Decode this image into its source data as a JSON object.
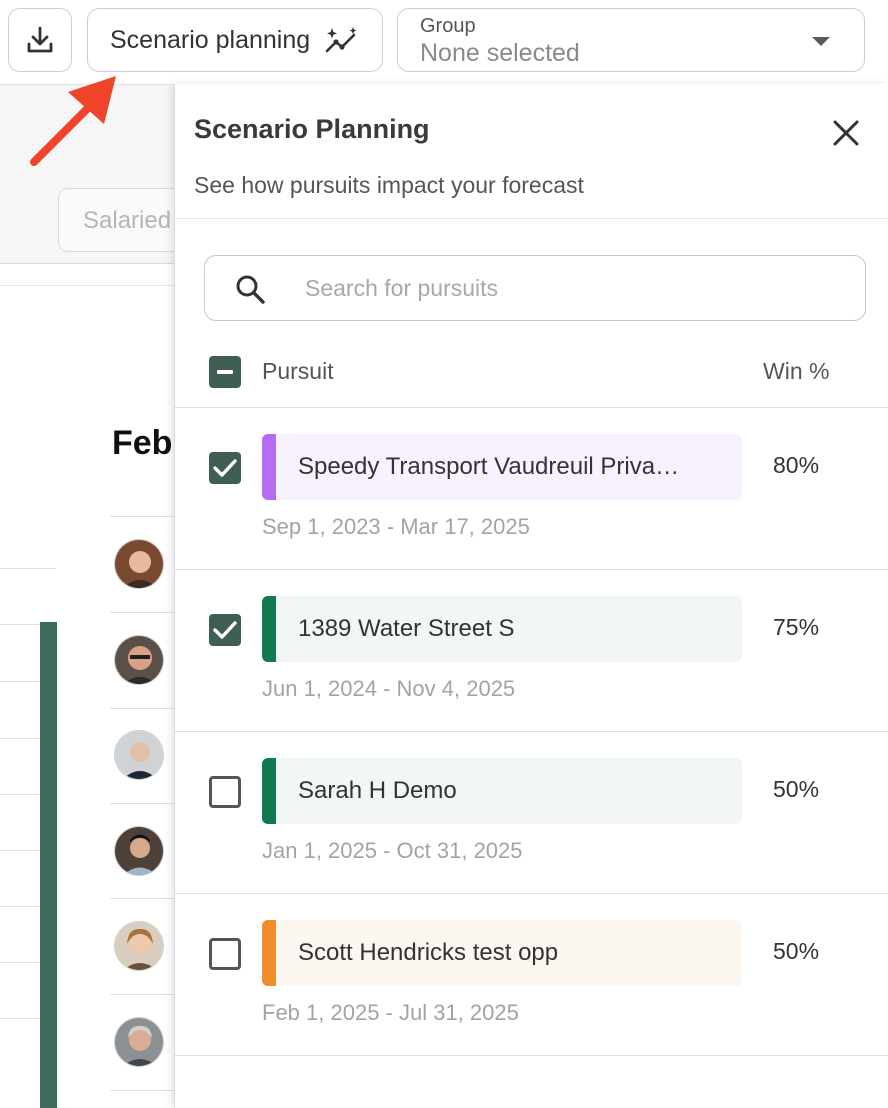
{
  "toolbar": {
    "download_icon": "download-icon",
    "scenario_label": "Scenario planning",
    "scenario_icon": "sparkle-chart-icon",
    "group": {
      "label": "Group",
      "value": "None selected"
    }
  },
  "background": {
    "filter_text": "Salaried",
    "month_title": "Febr"
  },
  "panel": {
    "title": "Scenario Planning",
    "subtitle": "See how pursuits impact your forecast",
    "search": {
      "placeholder": "Search for pursuits",
      "value": ""
    },
    "columns": {
      "pursuit": "Pursuit",
      "win": "Win %"
    },
    "pursuits": [
      {
        "name": "Speedy Transport Vaudreuil Priva…",
        "win": "80%",
        "dates": "Sep 1, 2023 - Mar 17, 2025",
        "checked": true,
        "color": "#b66cf2",
        "bg": "#f7f2fd"
      },
      {
        "name": "1389 Water Street S",
        "win": "75%",
        "dates": "Jun 1, 2024 - Nov 4, 2025",
        "checked": true,
        "color": "#0f7a4f",
        "bg": "#f2f6f4"
      },
      {
        "name": "Sarah H Demo",
        "win": "50%",
        "dates": "Jan 1, 2025 - Oct 31, 2025",
        "checked": false,
        "color": "#0f7a4f",
        "bg": "#f2f6f4"
      },
      {
        "name": "Scott Hendricks test opp",
        "win": "50%",
        "dates": "Feb 1, 2025 - Jul 31, 2025",
        "checked": false,
        "color": "#f08c2a",
        "bg": "#fdf7f2"
      }
    ]
  },
  "colors": {
    "accent": "#3f5e56",
    "annotation_arrow": "#f0442a"
  }
}
